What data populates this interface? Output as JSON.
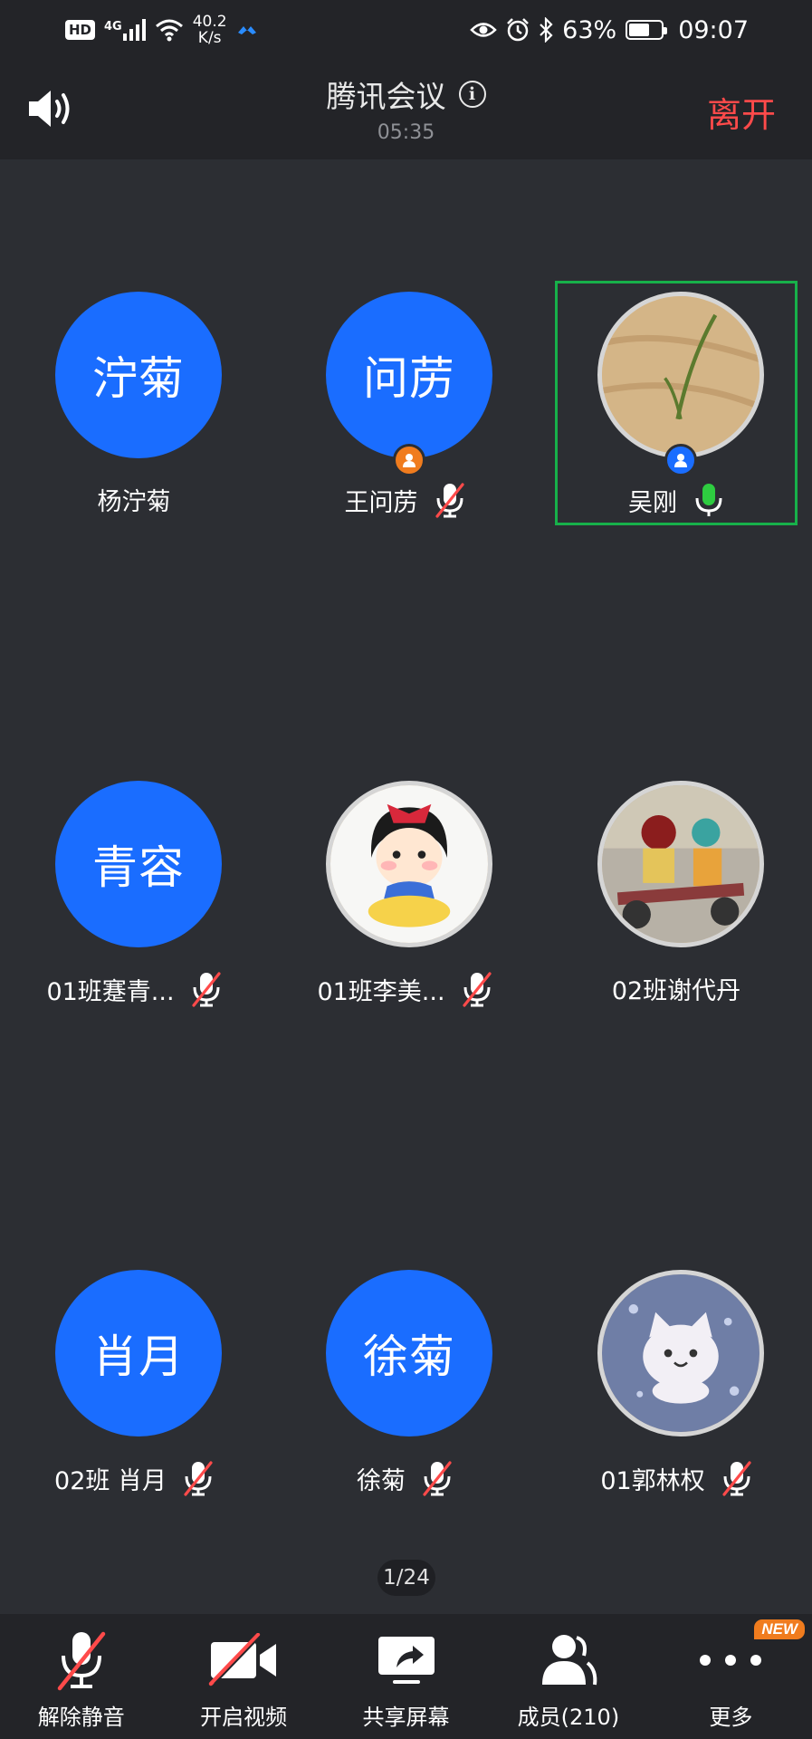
{
  "status_bar": {
    "hd": "HD",
    "network": "4G",
    "speed_value": "40.2",
    "speed_unit": "K/s",
    "battery": "63%",
    "battery_level": 0.63,
    "time": "09:07"
  },
  "header": {
    "title": "腾讯会议",
    "info_icon": "info-icon",
    "timer": "05:35",
    "leave_label": "离开",
    "speaker_icon": "speaker-icon"
  },
  "participants": [
    {
      "avatar_text": "泞菊",
      "name": "杨泞菊",
      "mic": "none",
      "avatar_type": "text",
      "role": "none",
      "active": false
    },
    {
      "avatar_text": "问苈",
      "name": "王问苈",
      "mic": "muted",
      "avatar_type": "text",
      "role": "host",
      "active": false
    },
    {
      "avatar_text": "",
      "name": "吴刚",
      "mic": "speaking",
      "avatar_type": "image-sand",
      "role": "cohost",
      "active": true
    },
    {
      "avatar_text": "青容",
      "name": "01班蹇青...",
      "mic": "muted",
      "avatar_type": "text",
      "role": "none",
      "active": false
    },
    {
      "avatar_text": "",
      "name": "01班李美...",
      "mic": "muted",
      "avatar_type": "image-cartoon-girl",
      "role": "none",
      "active": false
    },
    {
      "avatar_text": "",
      "name": "02班谢代丹",
      "mic": "none",
      "avatar_type": "image-scooter",
      "role": "none",
      "active": false
    },
    {
      "avatar_text": "肖月",
      "name": "02班 肖月",
      "mic": "muted",
      "avatar_type": "text",
      "role": "none",
      "active": false
    },
    {
      "avatar_text": "徐菊",
      "name": "徐菊",
      "mic": "muted",
      "avatar_type": "text",
      "role": "none",
      "active": false
    },
    {
      "avatar_text": "",
      "name": "01郭林权",
      "mic": "muted",
      "avatar_type": "image-cat",
      "role": "none",
      "active": false
    }
  ],
  "page_indicator": "1/24",
  "toolbar": {
    "unmute_label": "解除静音",
    "video_label": "开启视频",
    "share_label": "共享屏幕",
    "members_label": "成员",
    "members_count": "(210)",
    "more_label": "更多",
    "new_badge": "NEW"
  },
  "colors": {
    "background": "#2c2e33",
    "bar": "#232428",
    "avatar_blue": "#1a6dff",
    "leave_red": "#ff4a4a",
    "active_green": "#17b04a",
    "host_orange": "#f07c1e"
  }
}
